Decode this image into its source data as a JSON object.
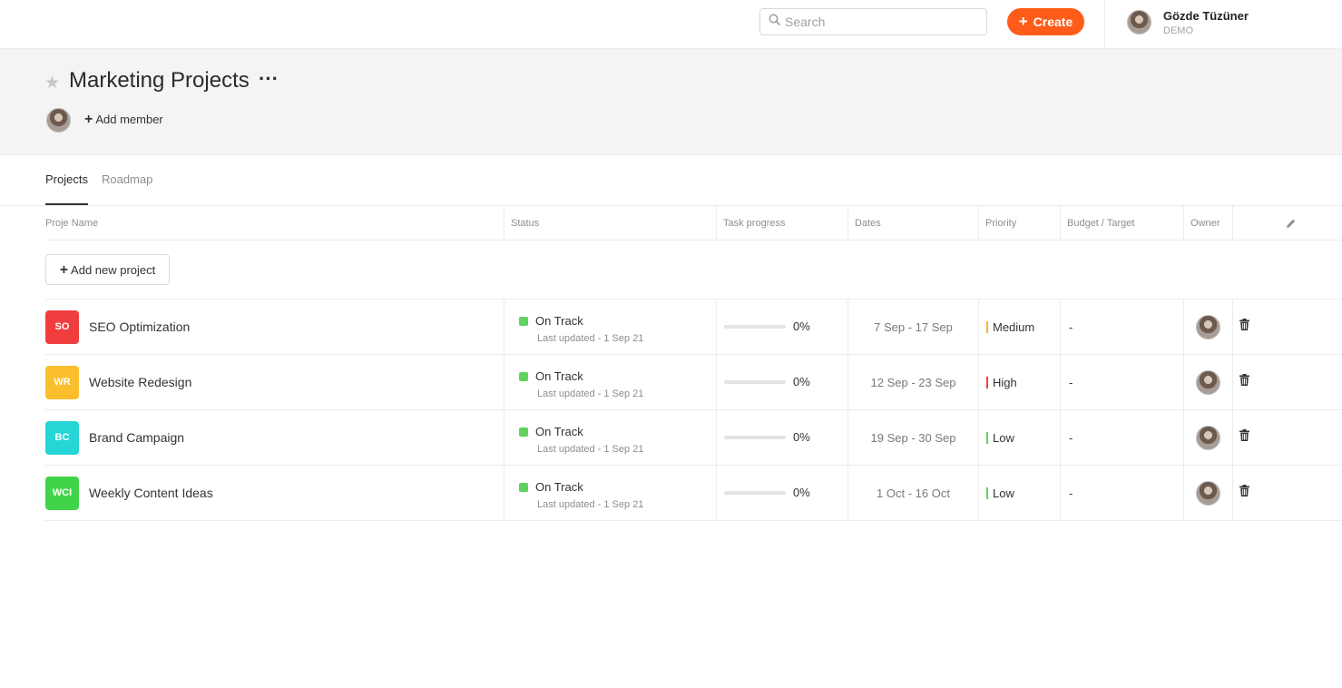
{
  "topbar": {
    "search_placeholder": "Search",
    "create_label": "Create",
    "create_plus": "+",
    "user_name": "Gözde Tüzüner",
    "user_role": "DEMO"
  },
  "header": {
    "title": "Marketing Projects",
    "more": "···",
    "add_member_plus": "+",
    "add_member_label": "Add member"
  },
  "tabs": [
    {
      "label": "Projects",
      "active": true
    },
    {
      "label": "Roadmap",
      "active": false
    }
  ],
  "table": {
    "columns": [
      "Proje Name",
      "Status",
      "Task progress",
      "Dates",
      "Priority",
      "Budget / Target",
      "Owner"
    ],
    "add_plus": "+",
    "add_project_label": "Add new project",
    "rows": [
      {
        "initials": "SO",
        "color": "#f03e3e",
        "name": "SEO Optimization",
        "status": "On Track",
        "updated": "Last updated - 1 Sep 21",
        "progress": 0,
        "progress_label": "0%",
        "dates": "7 Sep - 17 Sep",
        "priority": "Medium",
        "priority_color": "#f7b52c",
        "budget": "-"
      },
      {
        "initials": "WR",
        "color": "#fbbf2e",
        "name": "Website Redesign",
        "status": "On Track",
        "updated": "Last updated - 1 Sep 21",
        "progress": 0,
        "progress_label": "0%",
        "dates": "12 Sep - 23 Sep",
        "priority": "High",
        "priority_color": "#f03e3e",
        "budget": "-"
      },
      {
        "initials": "BC",
        "color": "#26d5d5",
        "name": "Brand Campaign",
        "status": "On Track",
        "updated": "Last updated - 1 Sep 21",
        "progress": 0,
        "progress_label": "0%",
        "dates": "19 Sep - 30 Sep",
        "priority": "Low",
        "priority_color": "#5fd35f",
        "budget": "-"
      },
      {
        "initials": "WCI",
        "color": "#40d44a",
        "name": "Weekly Content Ideas",
        "status": "On Track",
        "updated": "Last updated - 1 Sep 21",
        "progress": 0,
        "progress_label": "0%",
        "dates": "1 Oct - 16 Oct",
        "priority": "Low",
        "priority_color": "#5fd35f",
        "budget": "-"
      }
    ]
  },
  "colors": {
    "accent": "#ff5c1a",
    "status_on_track": "#5fd35f"
  },
  "icons": {
    "search": "search-icon",
    "star": "star-icon",
    "edit": "pencil-icon",
    "delete": "trash-icon"
  }
}
